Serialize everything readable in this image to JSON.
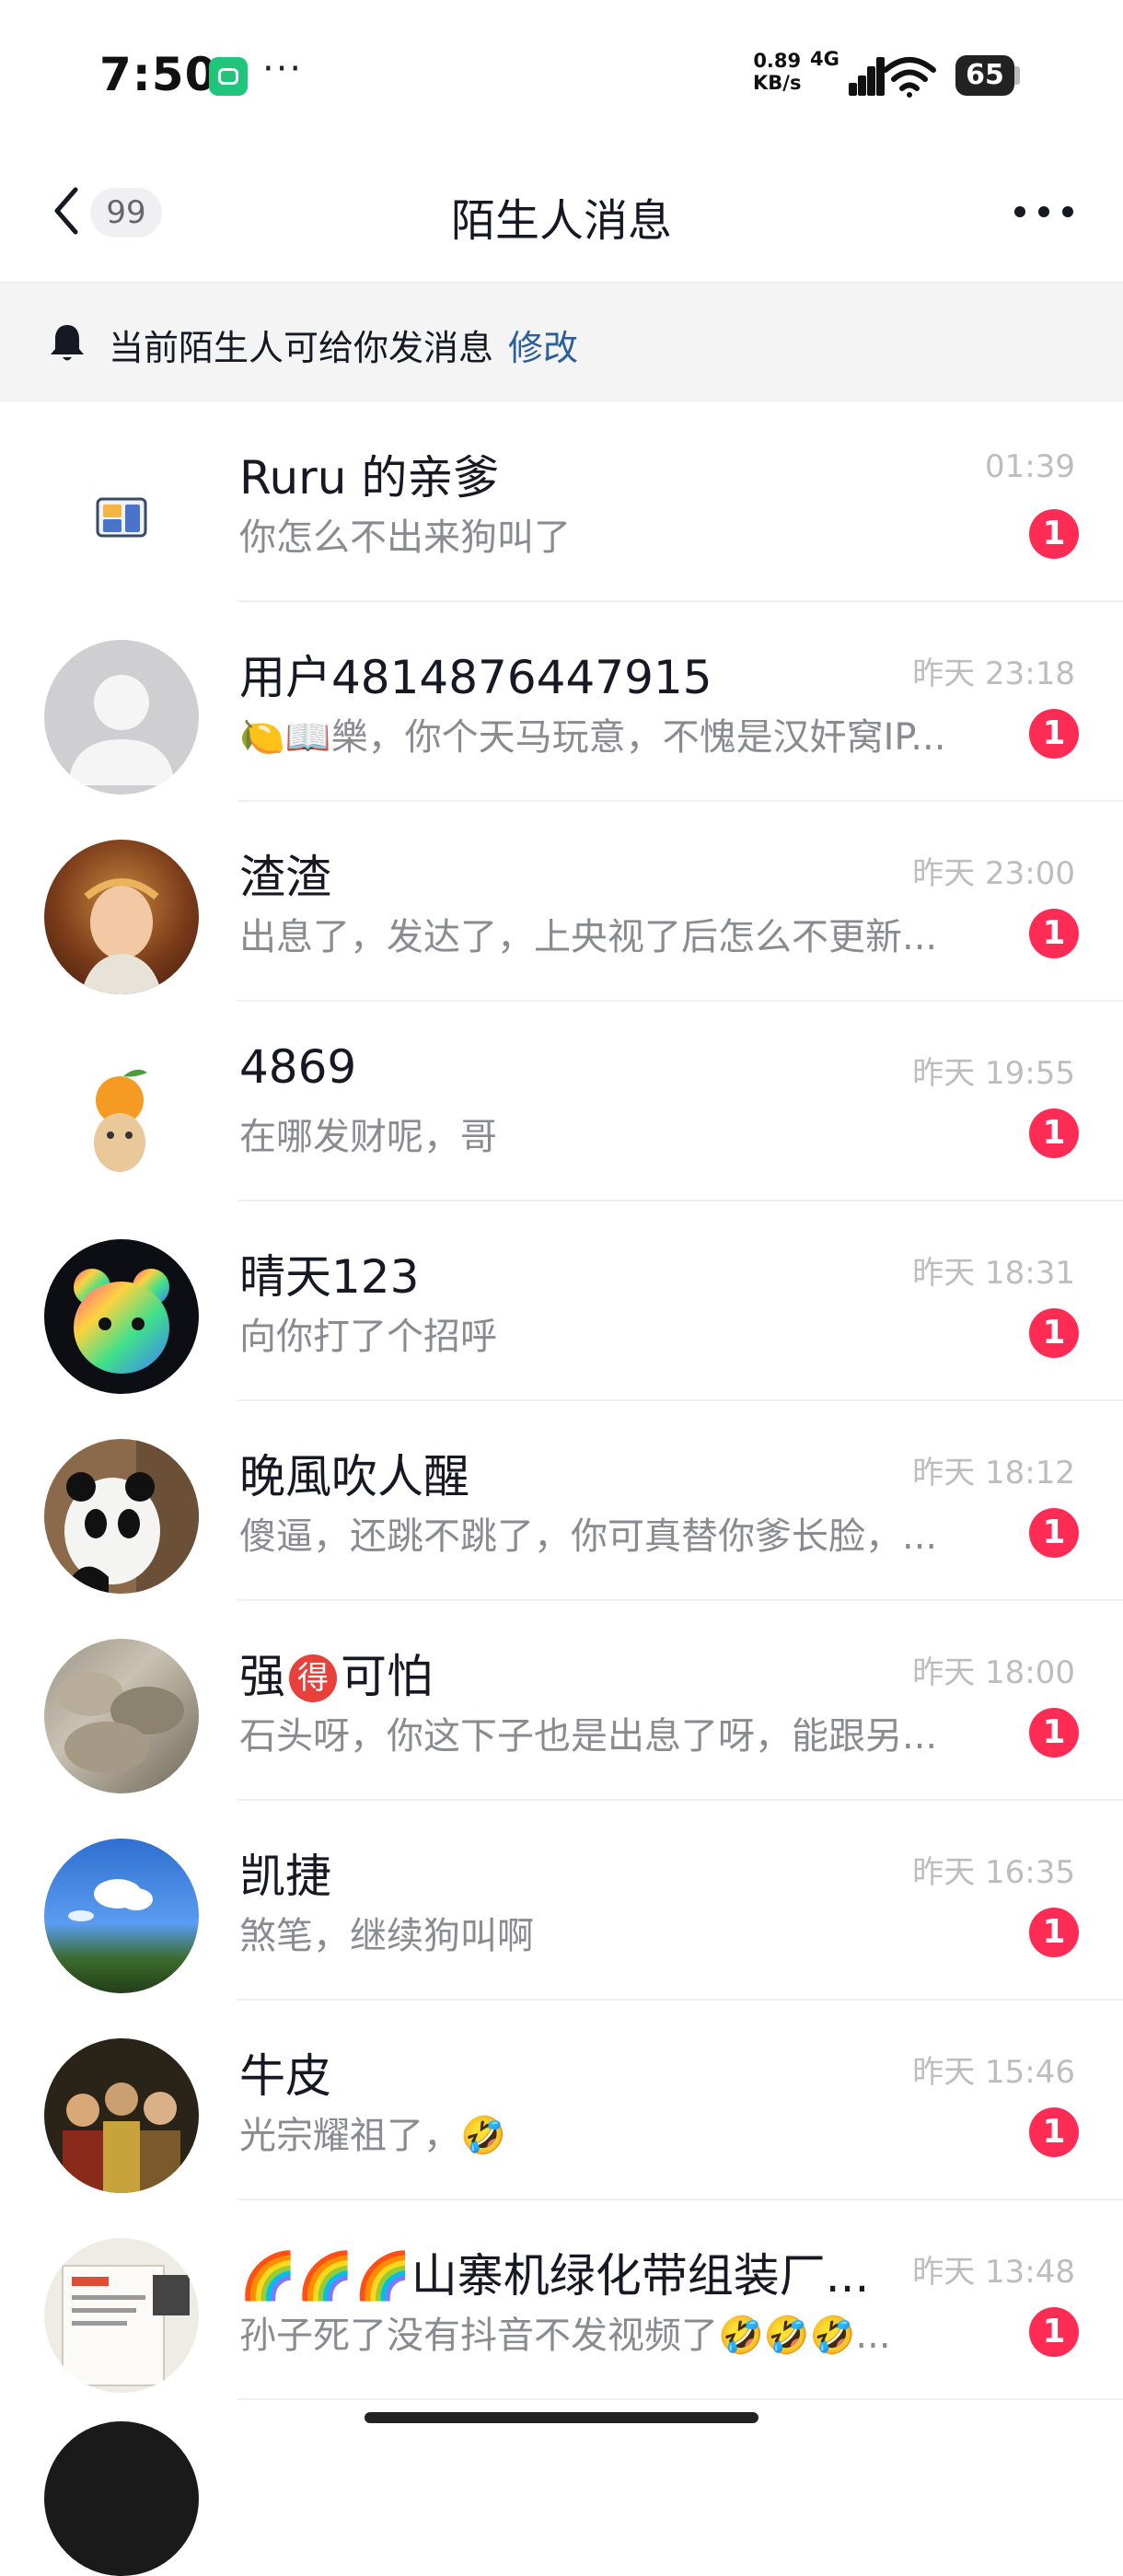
{
  "status_bar": {
    "time": "7:50",
    "more": "···",
    "net_speed_value": "0.89",
    "net_speed_unit": "KB/s",
    "network": "4G",
    "battery": "65"
  },
  "header": {
    "back_count": "99",
    "title": "陌生人消息"
  },
  "notice": {
    "text": "当前陌生人可给你发消息",
    "link": "修改"
  },
  "messages": [
    {
      "name": "Ruru 的亲爹",
      "time": "01:39",
      "preview": "你怎么不出来狗叫了",
      "badge": "1"
    },
    {
      "name": "用户4814876447915",
      "time": "昨天 23:18",
      "preview": "🍋📖樂，你个天马玩意，不愧是汉奸窝IP...",
      "badge": "1"
    },
    {
      "name": "渣渣",
      "time": "昨天 23:00",
      "preview": "出息了，发达了，上央视了后怎么不更新...",
      "badge": "1"
    },
    {
      "name": "4869",
      "time": "昨天 19:55",
      "preview": "在哪发财呢，哥",
      "badge": "1"
    },
    {
      "name": "晴天123",
      "time": "昨天 18:31",
      "preview": "向你打了个招呼",
      "badge": "1"
    },
    {
      "name": "晚風吹人醒",
      "time": "昨天 18:12",
      "preview": "傻逼，还跳不跳了，你可真替你爹长脸，...",
      "badge": "1"
    },
    {
      "name_pre": "强",
      "name_mid": "得",
      "name_post": "可怕",
      "time": "昨天 18:00",
      "preview": "石头呀，你这下子也是出息了呀，能跟另...",
      "badge": "1"
    },
    {
      "name": "凯捷",
      "time": "昨天 16:35",
      "preview": "煞笔，继续狗叫啊",
      "badge": "1"
    },
    {
      "name": "牛皮",
      "time": "昨天 15:46",
      "preview": "光宗耀祖了，🤣",
      "badge": "1"
    },
    {
      "name": "🌈🌈🌈山寨机绿化带组装厂...",
      "time": "昨天 13:48",
      "preview": "孙子死了没有抖音不发视频了🤣🤣🤣...",
      "badge": "1"
    }
  ],
  "colors": {
    "badge": "#fe2c55",
    "link": "#2a5f9c",
    "notice_bg": "#f4f4f5"
  }
}
